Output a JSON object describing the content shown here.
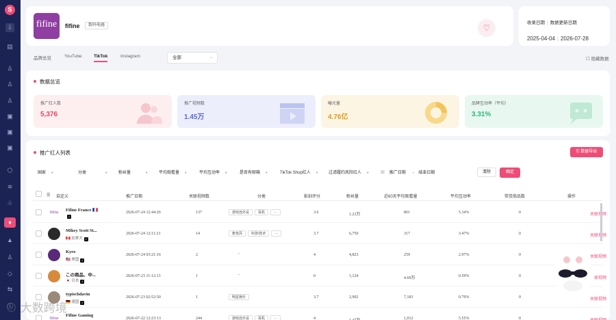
{
  "sidebar": {
    "logo": "S",
    "icons": [
      "download-icon",
      "list-icon",
      "user-icon",
      "user-icon",
      "user-icon",
      "doc-icon",
      "doc-icon",
      "doc-icon",
      "cube-icon",
      "stack-icon",
      "people-icon",
      "rank-icon",
      "diamond-icon",
      "triangle-icon",
      "person-icon",
      "layers-icon",
      "swap-icon",
      "info-icon"
    ]
  },
  "brand": {
    "logo_text": "fifine",
    "name": "fifine",
    "category": "数码电器"
  },
  "dates": {
    "collect_label": "收录日期",
    "update_label": "数据更新日期",
    "collect_date": "2025-04-04",
    "update_date": "2026-07-28"
  },
  "tabs": [
    "品牌总览",
    "YouTube",
    "TikTok",
    "Instagram"
  ],
  "region": "全部",
  "hide_data": "隐藏数据",
  "overview": {
    "title": "数据总览",
    "stats": [
      {
        "label": "推广红人数",
        "value": "5,376",
        "color": "#e8455e",
        "bg": "#fdeef0"
      },
      {
        "label": "推广视频数",
        "value": "1.45万",
        "color": "#5b6ad8",
        "bg": "#eceefc"
      },
      {
        "label": "曝光量",
        "value": "4.76亿",
        "color": "#e09a1a",
        "bg": "#fdf5e4"
      },
      {
        "label": "品牌互动率（平均）",
        "value": "3.31%",
        "color": "#2eb877",
        "bg": "#e8f8f1"
      }
    ]
  },
  "list": {
    "title": "推广红人列表",
    "export_label": "数据导出",
    "filters": [
      "国家",
      "分类",
      "粉丝量",
      "平均观看量",
      "平均互动率",
      "是否有邮箱",
      "TikTok Shop红人",
      "过滤履约风险红人"
    ],
    "date_start": "推广日期",
    "date_end": "结束日期",
    "clear_label": "清除",
    "confirm_label": "确定",
    "columns": [
      "自定义",
      "推广日期",
      "关联视频数",
      "分类",
      "影刻评分",
      "粉丝量",
      "近60天平均观看量",
      "平均互动率",
      "带货商品数",
      "操作"
    ],
    "rows": [
      {
        "name": "Fifine France 🇫🇷",
        "country": "",
        "flag": "",
        "date": "2026-07-24 12:44:26",
        "videos": "137",
        "tags": [
          "游戏自外设",
          "耳机",
          "···"
        ],
        "score": "3.6",
        "fans": "1.23万",
        "views": "861",
        "rate": "5.34%",
        "goods": "0",
        "avatar": "fifine",
        "avcolor": "#fff"
      },
      {
        "name": "Mikey Scott St...",
        "country": "加拿大",
        "flag": "🇨🇦",
        "date": "2026-07-24 12:11:21",
        "videos": "14",
        "tags": [
          "麦克风",
          "科技/技术",
          "···"
        ],
        "score": "3.7",
        "fans": "6,750",
        "views": "317",
        "rate": "3.47%",
        "goods": "0",
        "avatar": "",
        "avcolor": "#2a2a2a"
      },
      {
        "name": "Kyro",
        "country": "美国",
        "flag": "🇺🇸",
        "date": "2026-07-24 03:21:16",
        "videos": "2",
        "tags": [
          "-"
        ],
        "score": "4",
        "fans": "4,823",
        "views": "259",
        "rate": "2.97%",
        "goods": "0",
        "avatar": "",
        "avcolor": "#5a2a7a"
      },
      {
        "name": "この商品、中...",
        "country": "日本",
        "flag": "🇯🇵",
        "date": "2026-07-23 11:12:13",
        "videos": "1",
        "tags": [
          "-"
        ],
        "score": "0",
        "fans": "1,124",
        "views": "4.69万",
        "rate": "0.59%",
        "goods": "0",
        "avatar": "",
        "avcolor": "#d68a3a"
      },
      {
        "name": "typischdavin",
        "country": "德国",
        "flag": "🇩🇪",
        "date": "2026-07-23 02:52:50",
        "videos": "1",
        "tags": [
          "明星娱乐"
        ],
        "score": "3.7",
        "fans": "2,902",
        "views": "7,183",
        "rate": "0.79%",
        "goods": "0",
        "avatar": "",
        "avcolor": "#9a8a7a"
      },
      {
        "name": "Fifine Gaming",
        "country": "",
        "flag": "",
        "date": "2026-07-22 12:23:13",
        "videos": "244",
        "tags": [
          "游戏自外设",
          "耳机",
          "···"
        ],
        "score": "4",
        "fans": "1.47万",
        "views": "1,012",
        "rate": "5.55%",
        "goods": "0",
        "avatar": "fifine",
        "avcolor": "#fff"
      }
    ],
    "detail_label": "关联视频"
  },
  "watermark": "大数跨境"
}
